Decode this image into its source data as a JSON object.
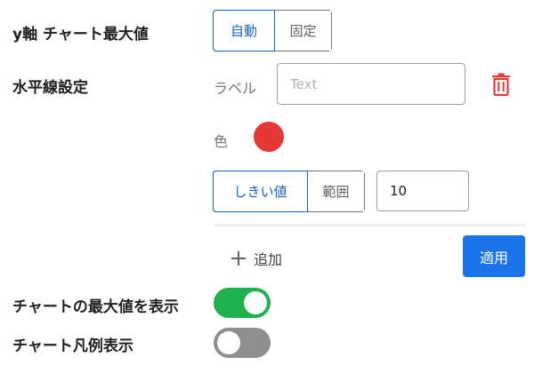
{
  "yaxis": {
    "label": "y軸 チャート最大値",
    "options": [
      "自動",
      "固定"
    ],
    "selected": "自動"
  },
  "hline": {
    "label": "水平線設定",
    "label_field_label": "ラベル",
    "label_placeholder": "Text",
    "label_value": "",
    "color_label": "色",
    "color": "#e53935",
    "mode_options": [
      "しきい値",
      "範囲"
    ],
    "mode_selected": "しきい値",
    "threshold_value": "10",
    "delete_icon": "trash-icon"
  },
  "actions": {
    "add_label": "追加",
    "apply_label": "適用"
  },
  "toggles": {
    "show_max": {
      "label": "チャートの最大値を表示",
      "on": true
    },
    "show_legend": {
      "label": "チャート凡例表示",
      "on": false
    }
  },
  "colors": {
    "accent": "#1a73e8",
    "toggle_on": "#1db24b",
    "toggle_off": "#8f8f8f",
    "danger": "#e53935"
  }
}
